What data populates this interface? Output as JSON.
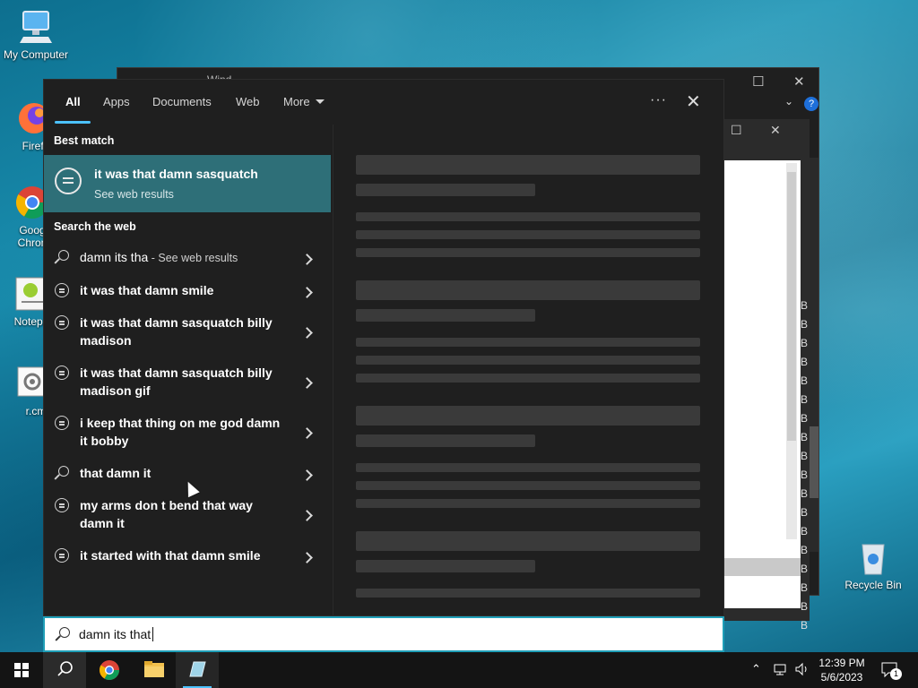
{
  "desktop": {
    "icons": [
      {
        "label": "My Computer"
      },
      {
        "label": "Firefo"
      },
      {
        "label": "Goog Chron"
      },
      {
        "label": "Notepa"
      },
      {
        "label": "r.cm"
      },
      {
        "label": "Recycle Bin"
      }
    ]
  },
  "background_window": {
    "title": "Wind",
    "b_letters": [
      "B",
      "B",
      "B",
      "B",
      "B",
      "B",
      "B",
      "B",
      "B",
      "B",
      "B",
      "B",
      "B",
      "B",
      "B",
      "B",
      "B",
      "B"
    ],
    "help_label": "?"
  },
  "search_panel": {
    "tabs": {
      "all": "All",
      "apps": "Apps",
      "documents": "Documents",
      "web": "Web",
      "more": "More"
    },
    "dots": "···",
    "close": "✕",
    "best_match_heading": "Best match",
    "best_match": {
      "title": "it was that damn sasquatch",
      "subtitle": "See web results"
    },
    "search_web_heading": "Search the web",
    "results": [
      {
        "icon": "search-icon",
        "bold": "damn its tha",
        "suffix": " - See web results"
      },
      {
        "icon": "chat-icon",
        "line": "it was that damn smile"
      },
      {
        "icon": "chat-icon",
        "line": "it was that damn sasquatch billy madison"
      },
      {
        "icon": "chat-icon",
        "line": "it was that damn sasquatch billy madison gif"
      },
      {
        "icon": "chat-icon",
        "line": "i keep that thing on me god damn it bobby"
      },
      {
        "icon": "search-icon",
        "line": "that damn it"
      },
      {
        "icon": "chat-icon",
        "line": "my arms don t bend that way damn it"
      },
      {
        "icon": "chat-icon",
        "line": "it started with that damn smile"
      }
    ]
  },
  "search_box": {
    "value": "damn its that"
  },
  "taskbar": {
    "time": "12:39 PM",
    "date": "5/6/2023",
    "notification_count": "1"
  },
  "colors": {
    "accent": "#4cc2ff",
    "best_match_bg": "#2e6f78",
    "panel_bg": "#1f1f1f",
    "search_border": "#1f9fb8"
  }
}
